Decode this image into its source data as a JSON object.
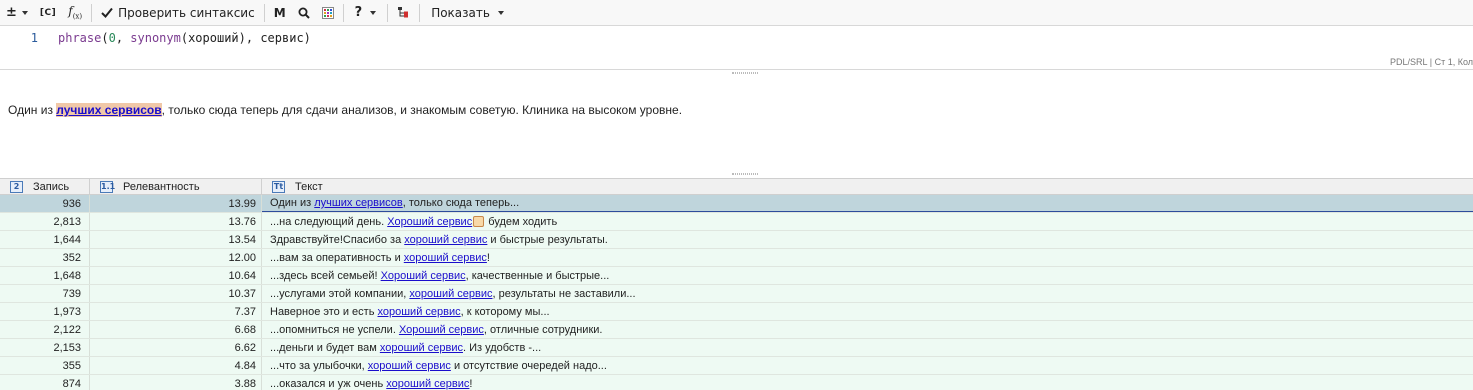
{
  "toolbar": {
    "plusminus": "±",
    "regex": "[C]",
    "fx": "f",
    "fx_sub": "(x)",
    "check_label": "Проверить синтаксис",
    "m_label": "M",
    "help_label": "?",
    "show_label": "Показать"
  },
  "editor": {
    "line_number": "1",
    "fn": "phrase",
    "open": "(",
    "num": "0",
    "sep1": ", ",
    "fn2": "synonym",
    "arg2": "(хороший), сервис)",
    "status": "PDL/SRL | Ст 1, Кол"
  },
  "preview": {
    "before": "Один из ",
    "highlight": "лучших сервисов",
    "after": ", только сюда теперь для сдачи анализов, и знакомым советую. Клиника на высоком уровне."
  },
  "table": {
    "headers": [
      {
        "icon": "2",
        "label": "Запись"
      },
      {
        "icon": "1.1",
        "label": "Релевантность"
      },
      {
        "icon": "Tt",
        "label": "Текст"
      }
    ],
    "rows": [
      {
        "record": "936",
        "relevance": "13.99",
        "before": "Один из ",
        "link": "лучших сервисов",
        "after": ", только сюда теперь..."
      },
      {
        "record": "2,813",
        "relevance": "13.76",
        "before": "...на следующий день. ",
        "link": "Хороший сервис",
        "after": " будем ходить"
      },
      {
        "record": "1,644",
        "relevance": "13.54",
        "before": "Здравствуйте!Спасибо за ",
        "link": "хороший сервис",
        "after": " и быстрые результаты."
      },
      {
        "record": "352",
        "relevance": "12.00",
        "before": "...вам за оперативность и ",
        "link": "хороший сервис",
        "after": "!"
      },
      {
        "record": "1,648",
        "relevance": "10.64",
        "before": "...здесь всей семьей! ",
        "link": "Хороший сервис",
        "after": ", качественные и быстрые..."
      },
      {
        "record": "739",
        "relevance": "10.37",
        "before": "...услугами этой компании, ",
        "link": "хороший сервис",
        "after": ", результаты не заставили..."
      },
      {
        "record": "1,973",
        "relevance": "7.37",
        "before": "Наверное это и есть ",
        "link": "хороший сервис",
        "after": ", к которому мы..."
      },
      {
        "record": "2,122",
        "relevance": "6.68",
        "before": "...опомниться не успели. ",
        "link": "Хороший сервис",
        "after": ", отличные сотрудники."
      },
      {
        "record": "2,153",
        "relevance": "6.62",
        "before": "...деньги и будет вам ",
        "link": "хороший сервис",
        "after": ". Из удобств -..."
      },
      {
        "record": "355",
        "relevance": "4.84",
        "before": "...что за улыбочки, ",
        "link": "хороший сервис",
        "after": " и отсутствие очередей надо..."
      },
      {
        "record": "874",
        "relevance": "3.88",
        "before": "...оказался и уж очень ",
        "link": "хороший сервис",
        "after": "!"
      }
    ]
  }
}
